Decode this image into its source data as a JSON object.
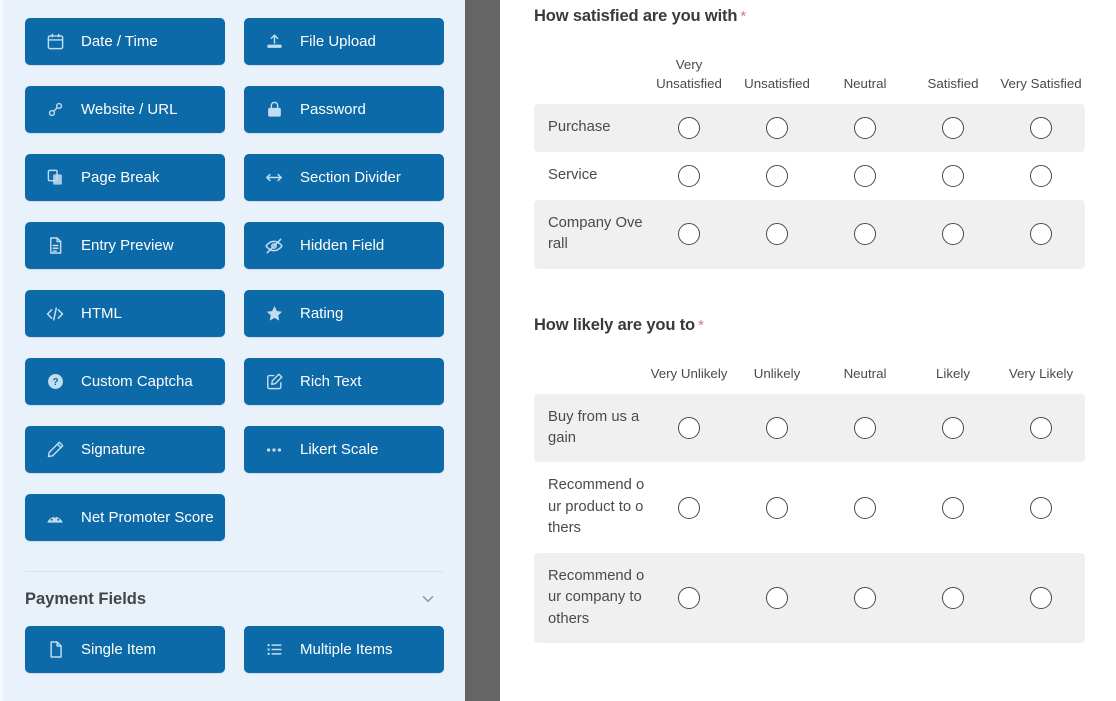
{
  "theme": {
    "sidebar_bg": "#e9f2fb",
    "button_bg": "#0b6aa7",
    "button_text": "#ffffff",
    "divider_gray": "#656565",
    "row_stripe": "#f0f0f0",
    "required_asterisk": "#d07a87"
  },
  "sidebar": {
    "fields": [
      {
        "label": "Date / Time",
        "icon": "calendar-icon"
      },
      {
        "label": "File Upload",
        "icon": "upload-icon"
      },
      {
        "label": "Website / URL",
        "icon": "link-icon"
      },
      {
        "label": "Password",
        "icon": "lock-icon"
      },
      {
        "label": "Page Break",
        "icon": "page-break-icon"
      },
      {
        "label": "Section Divider",
        "icon": "arrows-horizontal-icon"
      },
      {
        "label": "Entry Preview",
        "icon": "document-icon"
      },
      {
        "label": "Hidden Field",
        "icon": "eye-slash-icon"
      },
      {
        "label": "HTML",
        "icon": "code-icon"
      },
      {
        "label": "Rating",
        "icon": "star-icon"
      },
      {
        "label": "Custom Captcha",
        "icon": "question-circle-icon"
      },
      {
        "label": "Rich Text",
        "icon": "pencil-square-icon"
      },
      {
        "label": "Signature",
        "icon": "pen-icon"
      },
      {
        "label": "Likert Scale",
        "icon": "ellipsis-icon"
      },
      {
        "label": "Net Promoter Score",
        "icon": "gauge-icon"
      }
    ],
    "payment_section": {
      "title": "Payment Fields",
      "toggle_icon": "chevron-down-icon",
      "fields": [
        {
          "label": "Single Item",
          "icon": "file-icon"
        },
        {
          "label": "Multiple Items",
          "icon": "list-icon"
        }
      ]
    }
  },
  "main": {
    "questions": [
      {
        "title": "How satisfied are you with",
        "required_marker": "*",
        "columns": [
          "Very Unsatisfied",
          "Unsatisfied",
          "Neutral",
          "Satisfied",
          "Very Satisfied"
        ],
        "rows": [
          "Purchase",
          "Service",
          "Company Overall"
        ]
      },
      {
        "title": "How likely are you to",
        "required_marker": "*",
        "columns": [
          "Very Unlikely",
          "Unlikely",
          "Neutral",
          "Likely",
          "Very Likely"
        ],
        "rows": [
          "Buy from us again",
          "Recommend our product to others",
          "Recommend our company to others"
        ]
      }
    ]
  }
}
